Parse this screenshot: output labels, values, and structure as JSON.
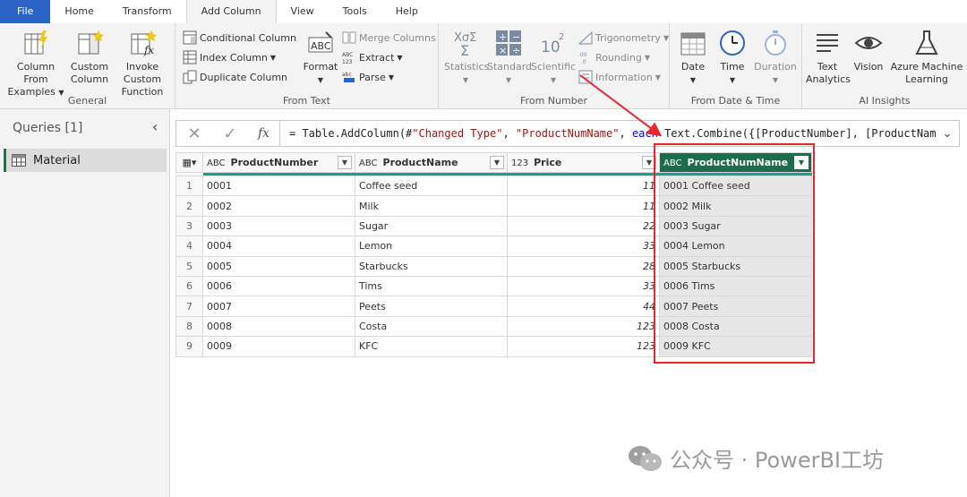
{
  "menu": {
    "tabs": [
      {
        "label": "File"
      },
      {
        "label": "Home"
      },
      {
        "label": "Transform"
      },
      {
        "label": "Add Column"
      },
      {
        "label": "View"
      },
      {
        "label": "Tools"
      },
      {
        "label": "Help"
      }
    ]
  },
  "ribbon": {
    "general": {
      "label": "General",
      "column_from_examples": [
        "Column From",
        "Examples"
      ],
      "custom_column": [
        "Custom",
        "Column"
      ],
      "invoke_custom_function": [
        "Invoke Custom",
        "Function"
      ]
    },
    "from_text": {
      "label": "From Text",
      "conditional_column": "Conditional Column",
      "index_column": "Index Column",
      "duplicate_column": "Duplicate Column",
      "format": "Format",
      "merge_columns": "Merge Columns",
      "extract": "Extract",
      "parse": "Parse"
    },
    "from_number": {
      "label": "From Number",
      "statistics": "Statistics",
      "standard": "Standard",
      "scientific": "Scientific",
      "trigonometry": "Trigonometry",
      "rounding": "Rounding",
      "information": "Information"
    },
    "from_date_time": {
      "label": "From Date & Time",
      "date": "Date",
      "time": "Time",
      "duration": "Duration"
    },
    "ai_insights": {
      "label": "AI Insights",
      "text_analytics": [
        "Text",
        "Analytics"
      ],
      "vision": "Vision",
      "azure_ml": [
        "Azure Machine",
        "Learning"
      ]
    }
  },
  "queries": {
    "title": "Queries [1]",
    "items": [
      {
        "label": "Material"
      }
    ]
  },
  "formula": {
    "part1": "= Table.AddColumn(#",
    "str1": "\"Changed Type\"",
    "sep1": ", ",
    "str2": "\"ProductNumName\"",
    "sep2": ", ",
    "kw": "each",
    "part2": " Text.Combine({[ProductNumber], [ProductName]"
  },
  "table": {
    "columns": [
      {
        "type": "ABC",
        "name": "ProductNumber"
      },
      {
        "type": "ABC",
        "name": "ProductName"
      },
      {
        "type": "123",
        "name": "Price"
      },
      {
        "type": "ABC",
        "name": "ProductNumName"
      }
    ],
    "rows": [
      {
        "n": "1",
        "num": "0001",
        "name": "Coffee seed",
        "price": "11",
        "combined": "0001 Coffee seed"
      },
      {
        "n": "2",
        "num": "0002",
        "name": "Milk",
        "price": "11",
        "combined": "0002 Milk"
      },
      {
        "n": "3",
        "num": "0003",
        "name": "Sugar",
        "price": "22",
        "combined": "0003 Sugar"
      },
      {
        "n": "4",
        "num": "0004",
        "name": "Lemon",
        "price": "33",
        "combined": "0004 Lemon"
      },
      {
        "n": "5",
        "num": "0005",
        "name": "Starbucks",
        "price": "28",
        "combined": "0005 Starbucks"
      },
      {
        "n": "6",
        "num": "0006",
        "name": "Tims",
        "price": "33",
        "combined": "0006 Tims"
      },
      {
        "n": "7",
        "num": "0007",
        "name": "Peets",
        "price": "44",
        "combined": "0007 Peets"
      },
      {
        "n": "8",
        "num": "0008",
        "name": "Costa",
        "price": "123",
        "combined": "0008 Costa"
      },
      {
        "n": "9",
        "num": "0009",
        "name": "KFC",
        "price": "123",
        "combined": "0009 KFC"
      }
    ]
  },
  "watermark": "公众号 · PowerBI工坊",
  "colors": {
    "file_tab": "#2b64c6",
    "selected_header": "#1e6b4e",
    "highlight": "#e8262e"
  }
}
